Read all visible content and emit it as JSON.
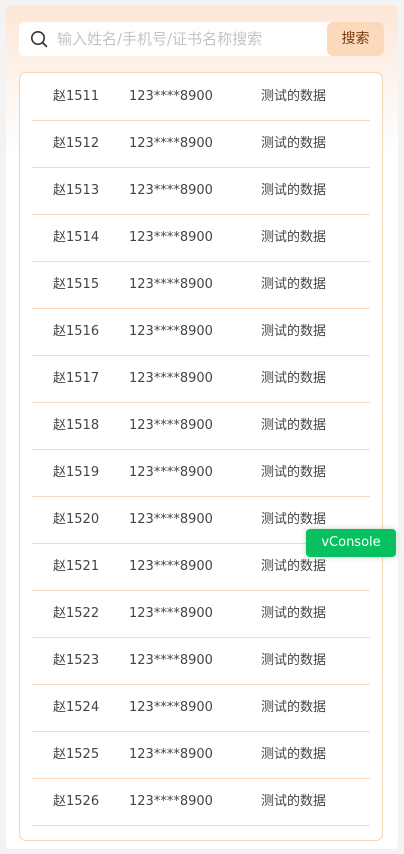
{
  "search": {
    "placeholder": "输入姓名/手机号/证书名称搜索",
    "value": "",
    "button_label": "搜索",
    "icon": "search-icon"
  },
  "list": {
    "items": [
      {
        "name": "赵1511",
        "phone": "123****8900",
        "info": "测试的数据"
      },
      {
        "name": "赵1512",
        "phone": "123****8900",
        "info": "测试的数据"
      },
      {
        "name": "赵1513",
        "phone": "123****8900",
        "info": "测试的数据"
      },
      {
        "name": "赵1514",
        "phone": "123****8900",
        "info": "测试的数据"
      },
      {
        "name": "赵1515",
        "phone": "123****8900",
        "info": "测试的数据"
      },
      {
        "name": "赵1516",
        "phone": "123****8900",
        "info": "测试的数据"
      },
      {
        "name": "赵1517",
        "phone": "123****8900",
        "info": "测试的数据"
      },
      {
        "name": "赵1518",
        "phone": "123****8900",
        "info": "测试的数据"
      },
      {
        "name": "赵1519",
        "phone": "123****8900",
        "info": "测试的数据"
      },
      {
        "name": "赵1520",
        "phone": "123****8900",
        "info": "测试的数据"
      },
      {
        "name": "赵1521",
        "phone": "123****8900",
        "info": "测试的数据"
      },
      {
        "name": "赵1522",
        "phone": "123****8900",
        "info": "测试的数据"
      },
      {
        "name": "赵1523",
        "phone": "123****8900",
        "info": "测试的数据"
      },
      {
        "name": "赵1524",
        "phone": "123****8900",
        "info": "测试的数据"
      },
      {
        "name": "赵1525",
        "phone": "123****8900",
        "info": "测试的数据"
      },
      {
        "name": "赵1526",
        "phone": "123****8900",
        "info": "测试的数据"
      }
    ]
  },
  "vconsole": {
    "label": "vConsole"
  },
  "colors": {
    "accent": "#fdd9bb",
    "row_divider": "#fbd8c0",
    "vconsole_green": "#07c160"
  }
}
